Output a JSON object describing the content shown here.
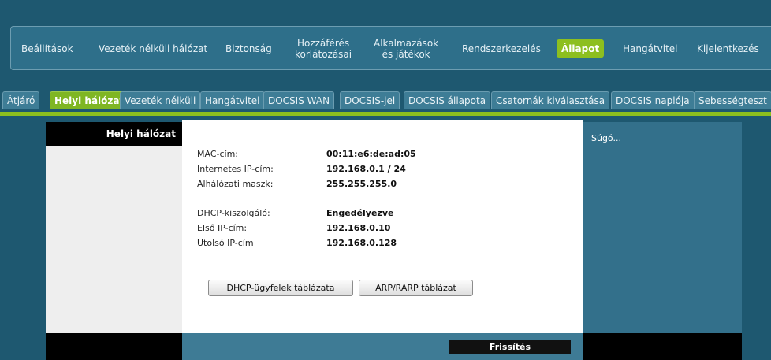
{
  "topnav": {
    "items": [
      {
        "label": "Beállítások"
      },
      {
        "label": "Vezeték nélküli hálózat"
      },
      {
        "label": "Biztonság"
      },
      {
        "line1": "Hozzáférés",
        "line2": "korlátozásai"
      },
      {
        "line1": "Alkalmazások",
        "line2": "és játékok"
      },
      {
        "label": "Rendszerkezelés"
      },
      {
        "label": "Állapot"
      },
      {
        "label": "Hangátvitel"
      },
      {
        "label": "Kijelentkezés"
      }
    ],
    "active_color": "#8dbf1f"
  },
  "subtabs": [
    {
      "label": "Átjáró"
    },
    {
      "label": "Helyi hálózat"
    },
    {
      "label": "Vezeték nélküli"
    },
    {
      "label": "Hangátvitel"
    },
    {
      "label": "DOCSIS WAN"
    },
    {
      "label": "DOCSIS-jel"
    },
    {
      "label": "DOCSIS állapota"
    },
    {
      "label": "Csatornák kiválasztása"
    },
    {
      "label": "DOCSIS naplója"
    },
    {
      "label": "Sebességteszt"
    }
  ],
  "left_panel": {
    "title": "Helyi hálózat"
  },
  "main": {
    "rows": [
      {
        "label": "MAC-cím:",
        "value": "00:11:e6:de:ad:05"
      },
      {
        "label": "Internetes IP-cím:",
        "value": "192.168.0.1 / 24"
      },
      {
        "label": "Alhálózati maszk:",
        "value": "255.255.255.0"
      },
      {
        "label": "DHCP-kiszolgáló:",
        "value": "Engedélyezve"
      },
      {
        "label": "Első IP-cím:",
        "value": "192.168.0.10"
      },
      {
        "label": "Utolsó IP-cím",
        "value": "192.168.0.128"
      }
    ],
    "buttons": {
      "dhcp_clients": "DHCP-ügyfelek táblázata",
      "arp_rarp": "ARP/RARP táblázat"
    },
    "refresh_label": "Frissítés"
  },
  "help": {
    "title": "Súgó..."
  },
  "colors": {
    "navy": "#1e5870",
    "accent_green": "#8dbf1f",
    "help_panel": "#33708b"
  }
}
